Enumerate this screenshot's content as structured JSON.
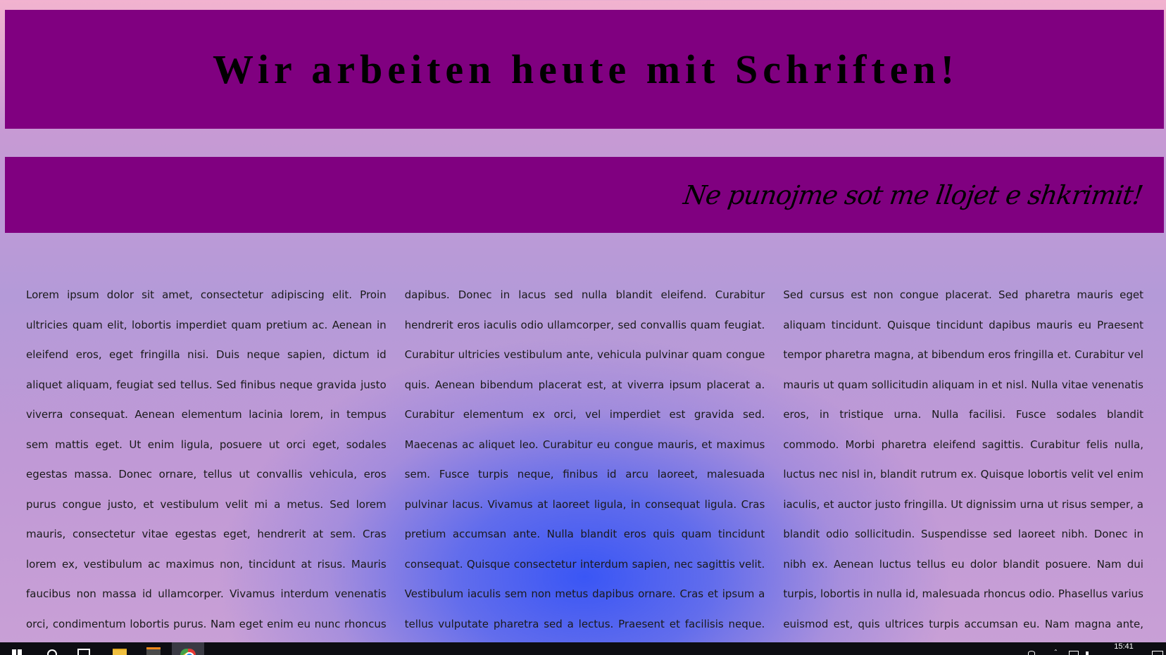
{
  "header": {
    "title": "Wir arbeiten heute mit Schriften!"
  },
  "subheader": {
    "title": "Ne punojme sot me llojet e shkrimit!"
  },
  "article": {
    "text": "Lorem ipsum dolor sit amet, consectetur adipiscing elit. Proin ultricies quam elit, lobortis imperdiet quam pretium ac. Aenean in eleifend eros, eget fringilla nisi. Duis neque sapien, dictum id aliquet aliquam, feugiat sed tellus. Sed finibus neque gravida justo viverra consequat. Aenean elementum lacinia lorem, in tempus sem mattis eget. Ut enim ligula, posuere ut orci eget, sodales egestas massa. Donec ornare, tellus ut convallis vehicula, eros purus congue justo, et vestibulum velit mi a metus. Sed lorem mauris, consectetur vitae egestas eget, hendrerit at sem. Cras lorem ex, vestibulum ac maximus non, tincidunt at risus. Mauris faucibus non massa id ullamcorper. Vivamus interdum venenatis orci, condimentum lobortis purus. Nam eget enim eu nunc rhoncus dapibus. Donec in lacus sed nulla blandit eleifend. Curabitur hendrerit eros iaculis odio ullamcorper, sed convallis quam feugiat. Curabitur ultricies vestibulum ante, vehicula pulvinar quam congue quis. Aenean bibendum placerat est, at viverra ipsum placerat a. Curabitur elementum ex orci, vel imperdiet est gravida sed. Maecenas ac aliquet leo. Curabitur eu congue mauris, et maximus sem. Fusce turpis neque, finibus id arcu laoreet, malesuada pulvinar lacus. Vivamus at laoreet ligula, in consequat ligula. Cras pretium accumsan ante. Nulla blandit eros quis quam tincidunt consequat. Quisque consectetur interdum sapien, nec sagittis velit. Vestibulum iaculis sem non metus dapibus ornare. Cras et ipsum a tellus vulputate pharetra sed a lectus. Praesent et facilisis neque. Sed cursus est non congue placerat. Sed pharetra mauris eget aliquam tincidunt. Quisque tincidunt dapibus mauris eu Praesent tempor pharetra magna, at bibendum eros fringilla et. Curabitur vel mauris ut quam sollicitudin aliquam in et nisl. Nulla vitae venenatis eros, in tristique urna. Nulla facilisi. Fusce sodales blandit commodo. Morbi pharetra eleifend sagittis. Curabitur felis nulla, luctus nec nisl in, blandit rutrum ex. Quisque lobortis velit vel enim iaculis, et auctor justo fringilla. Ut dignissim urna ut risus semper, a blandit odio sollicitudin. Suspendisse sed laoreet nibh. Donec in nibh ex. Aenean luctus tellus eu dolor blandit posuere. Nam dui turpis, lobortis in nulla id, malesuada rhoncus odio. Phasellus varius euismod est, quis ultrices turpis accumsan eu. Nam magna ante, ornare et ligula sed, feugiat hendrerit purus. Nam iaculis diam suscipit elit pharetra finibus. Phasellus suscipit vestibulum urna, non sagittis arcu pulvinar in. Nam"
  },
  "taskbar": {
    "clock": "15:41",
    "apps": [
      "start",
      "search",
      "task-view",
      "file-explorer",
      "sublime-text",
      "chrome"
    ]
  },
  "colors": {
    "banner": "#800080",
    "text": "#1a1a1a",
    "taskbar": "#0d0d12"
  },
  "icons": [
    "windows-start-icon",
    "search-icon",
    "task-view-icon",
    "folder-icon",
    "sublime-text-icon",
    "chrome-icon",
    "people-icon",
    "chevron-up-icon",
    "network-icon",
    "volume-icon",
    "notification-icon"
  ]
}
